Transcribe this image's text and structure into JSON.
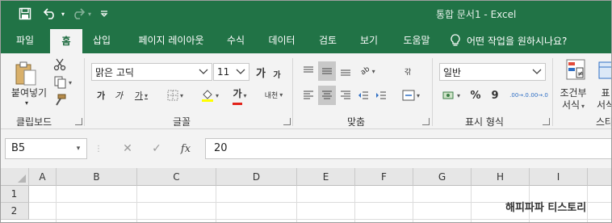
{
  "window": {
    "title": "통합 문서1  -  Excel"
  },
  "tabs": [
    "파일",
    "홈",
    "삽입",
    "페이지 레이아웃",
    "수식",
    "데이터",
    "검토",
    "보기",
    "도움말"
  ],
  "tell_me": "어떤 작업을 원하시나요?",
  "clipboard": {
    "paste_label": "붙여넣기",
    "group_label": "클립보드"
  },
  "font": {
    "name": "맑은 고딕",
    "size": "11",
    "grow": "가",
    "shrink": "가",
    "bold": "가",
    "italic": "가",
    "underline": "가",
    "font_color_glyph": "가",
    "phonetic": "내천",
    "group_label": "글꼴"
  },
  "alignment": {
    "group_label": "맞춤",
    "wrap_glyph": "갂",
    "orientation_glyph": "ab"
  },
  "number": {
    "format": "일반",
    "percent": "%",
    "comma": "9",
    "inc_decimal": ".00→.0",
    "dec_decimal": ".00→.0",
    "group_label": "표시 형식"
  },
  "styles": {
    "conditional_line1": "조건부",
    "conditional_line2": "서식",
    "table_partial_1": "표",
    "table_partial_2": "서식",
    "group_label_partial": "스타"
  },
  "formula_bar": {
    "name_box": "B5",
    "fx": "fx",
    "value": "20"
  },
  "grid": {
    "columns": [
      "A",
      "B",
      "C",
      "D",
      "E",
      "F",
      "G",
      "H",
      "I"
    ],
    "rows": [
      "1",
      "2"
    ]
  },
  "watermark": "해피파파 티스토리",
  "colors": {
    "excel_green": "#217346",
    "ribbon_bg": "#f3f3f3",
    "header_bg": "#e6e6e6"
  }
}
